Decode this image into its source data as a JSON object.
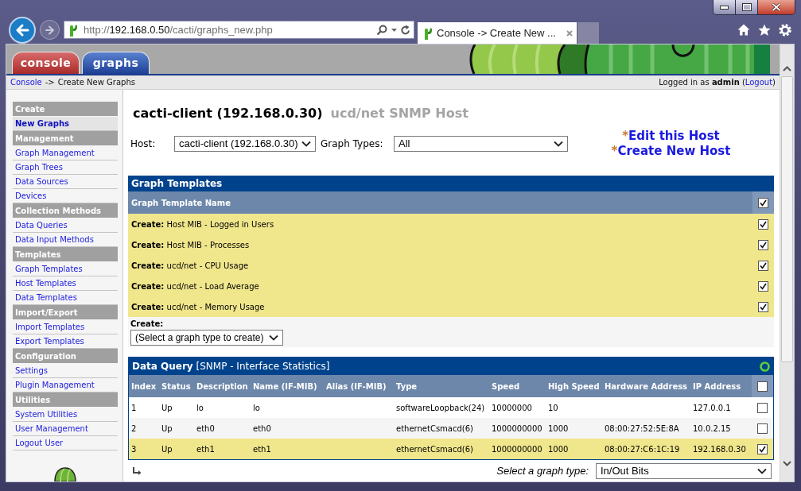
{
  "browser": {
    "address": {
      "scheme": "http://",
      "host": "192.168.0.50",
      "path": "/cacti/graphs_new.php"
    },
    "tab_title": "Console -> Create New ..."
  },
  "header_tabs": [
    {
      "label": "console",
      "selected": true
    },
    {
      "label": "graphs",
      "selected": false
    }
  ],
  "breadcrumb": {
    "parent": "Console",
    "separator": "->",
    "current": "Create New Graphs"
  },
  "login": {
    "text": "Logged in as **admin** (",
    "link": "Logout",
    "suffix": ")"
  },
  "sidebar": {
    "sections": [
      {
        "title": "Create",
        "items": [
          {
            "label": "New Graphs",
            "selected": true
          }
        ]
      },
      {
        "title": "Management",
        "items": [
          {
            "label": "Graph Management",
            "selected": false
          },
          {
            "label": "Graph Trees",
            "selected": false
          },
          {
            "label": "Data Sources",
            "selected": false
          },
          {
            "label": "Devices",
            "selected": false
          }
        ]
      },
      {
        "title": "Collection Methods",
        "items": [
          {
            "label": "Data Queries",
            "selected": false
          },
          {
            "label": "Data Input Methods",
            "selected": false
          }
        ]
      },
      {
        "title": "Templates",
        "items": [
          {
            "label": "Graph Templates",
            "selected": false
          },
          {
            "label": "Host Templates",
            "selected": false
          },
          {
            "label": "Data Templates",
            "selected": false
          }
        ]
      },
      {
        "title": "Import/Export",
        "items": [
          {
            "label": "Import Templates",
            "selected": false
          },
          {
            "label": "Export Templates",
            "selected": false
          }
        ]
      },
      {
        "title": "Configuration",
        "items": [
          {
            "label": "Settings",
            "selected": false
          },
          {
            "label": "Plugin Management",
            "selected": false
          }
        ]
      },
      {
        "title": "Utilities",
        "items": [
          {
            "label": "System Utilities",
            "selected": false
          },
          {
            "label": "User Management",
            "selected": false
          },
          {
            "label": "Logout User",
            "selected": false
          }
        ]
      }
    ]
  },
  "host_title": {
    "name": "cacti-client (192.168.0.30)",
    "template": "ucd/net SNMP Host"
  },
  "filters": [
    {
      "label": "Host:",
      "value": "cacti-client (192.168.0.30)"
    },
    {
      "label": "Graph Types:",
      "value": "All"
    }
  ],
  "host_links": [
    {
      "marker": "*",
      "label": "Edit this Host"
    },
    {
      "marker": "*",
      "label": "Create New Host"
    }
  ],
  "graph_templates": {
    "title": "Graph Templates",
    "column": "Graph Template Name",
    "all_checked": true,
    "rows": [
      {
        "text": "**Create:** Host MIB - Logged in Users",
        "checked": true
      },
      {
        "text": "**Create:** Host MIB - Processes",
        "checked": true
      },
      {
        "text": "**Create:** ucd/net - CPU Usage",
        "checked": true
      },
      {
        "text": "**Create:** ucd/net - Load Average",
        "checked": true
      },
      {
        "text": "**Create:** ucd/net - Memory Usage",
        "checked": true
      }
    ],
    "create_label": "Create:",
    "create_select": "(Select a graph type to create)"
  },
  "data_query": {
    "title": "**Data Query** [SNMP - Interface Statistics]",
    "columns": [
      "Index",
      "Status",
      "Description",
      "Name (IF-MIB)",
      "Alias (IF-MIB)",
      "Type",
      "Speed",
      "High Speed",
      "Hardware Address",
      "IP Address"
    ],
    "all_checked": false,
    "rows": [
      {
        "cells": [
          "1",
          "Up",
          "lo",
          "lo",
          null,
          "softwareLoopback(24)",
          "10000000",
          "10",
          null,
          "127.0.0.1"
        ],
        "checked": false
      },
      {
        "cells": [
          "2",
          "Up",
          "eth0",
          "eth0",
          null,
          "ethernetCsmacd(6)",
          "1000000000",
          "1000",
          "08:00:27:52:5E:8A",
          "10.0.2.15"
        ],
        "checked": false
      },
      {
        "cells": [
          "3",
          "Up",
          "eth1",
          "eth1",
          null,
          "ethernetCsmacd(6)",
          "1000000000",
          "1000",
          "08:00:27:C6:1C:19",
          "192.168.0.30"
        ],
        "checked": true
      }
    ],
    "graph_type_label": "Select a graph type:",
    "graph_type": "In/Out Bits"
  }
}
